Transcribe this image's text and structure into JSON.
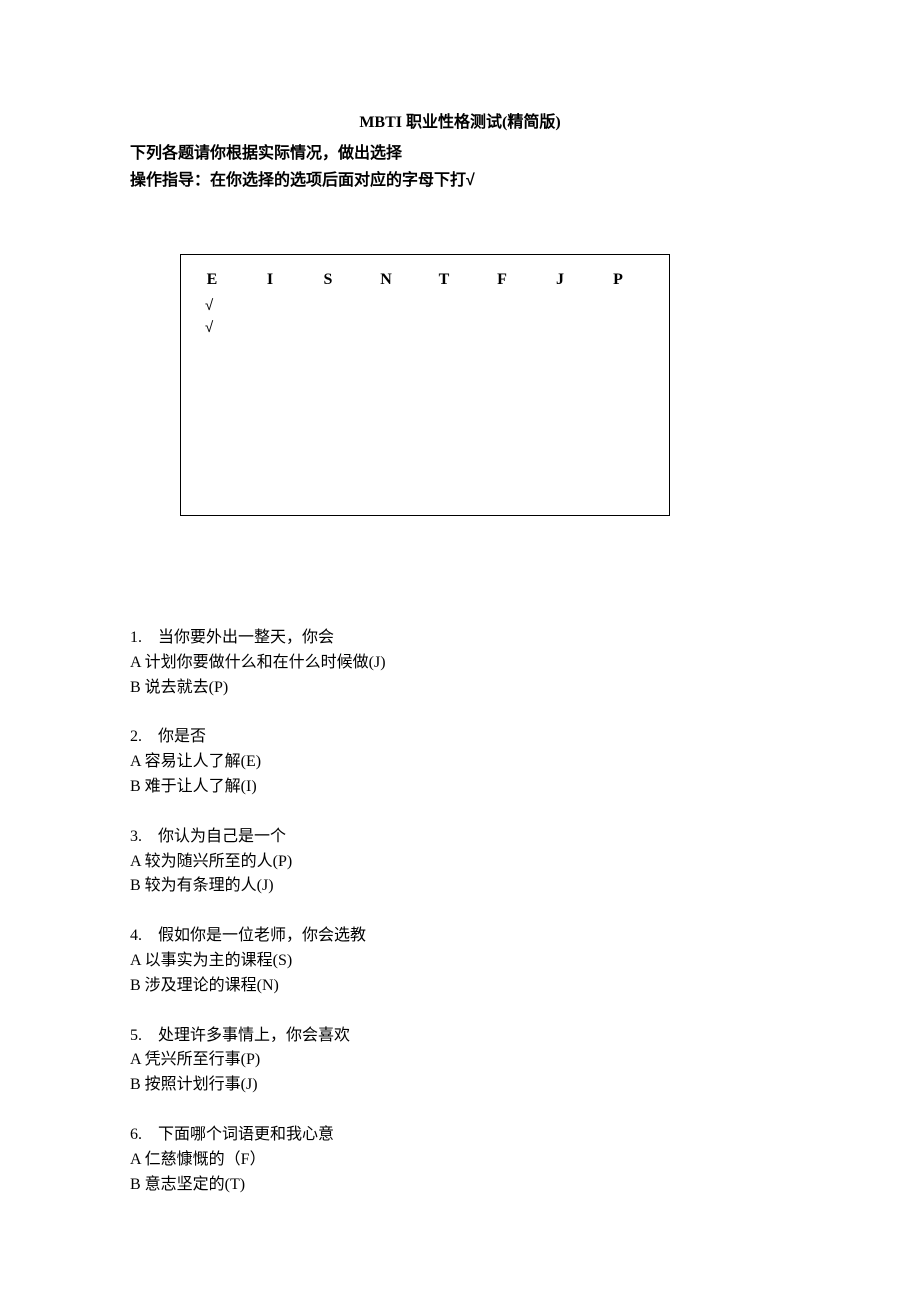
{
  "title": "MBTI 职业性格测试(精简版)",
  "subtitle": {
    "line1": "下列各题请你根据实际情况，做出选择",
    "line2_prefix": "操作指导：在你选择的选项后面对应的字母下打",
    "check_mark": "√"
  },
  "table": {
    "headers": [
      "E",
      "I",
      "S",
      "N",
      "T",
      "F",
      "J",
      "P"
    ],
    "check_rows": [
      "√",
      "√"
    ]
  },
  "questions": [
    {
      "num": "1.",
      "stem": "当你要外出一整天，你会",
      "a": "A  计划你要做什么和在什么时候做(J)",
      "b": "B  说去就去(P)"
    },
    {
      "num": "2.",
      "stem": "你是否",
      "a": "A 容易让人了解(E)",
      "b": "B 难于让人了解(I)"
    },
    {
      "num": "3.",
      "stem": "你认为自己是一个",
      "a": "A  较为随兴所至的人(P)",
      "b": "B  较为有条理的人(J)"
    },
    {
      "num": "4.",
      "stem": "假如你是一位老师，你会选教",
      "a": "A 以事实为主的课程(S)",
      "b": "B 涉及理论的课程(N)"
    },
    {
      "num": "5.",
      "stem": "处理许多事情上，你会喜欢",
      "a": "A 凭兴所至行事(P)",
      "b": "B 按照计划行事(J)"
    },
    {
      "num": "6.",
      "stem": "下面哪个词语更和我心意",
      "a": "A 仁慈慷慨的（F）",
      "b": "B 意志坚定的(T)"
    }
  ]
}
